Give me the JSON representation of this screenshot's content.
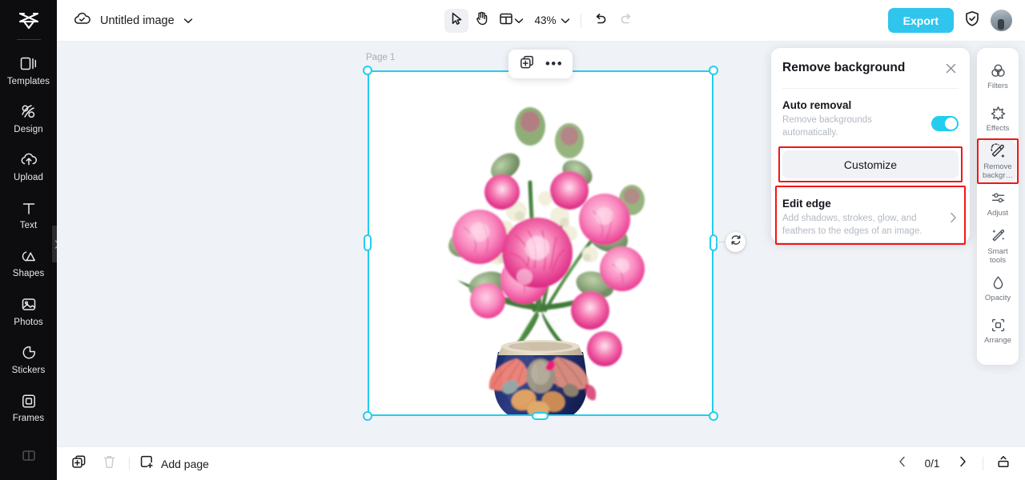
{
  "app": {
    "brand_icon": "capcut-logo-icon",
    "canvas_bg": "#eff2f6",
    "accent": "#22cdf0",
    "annotation_color": "#f31515"
  },
  "sidebar": {
    "items": [
      {
        "label": "Templates",
        "icon": "templates-icon"
      },
      {
        "label": "Design",
        "icon": "design-icon"
      },
      {
        "label": "Upload",
        "icon": "upload-cloud-icon"
      },
      {
        "label": "Text",
        "icon": "text-icon"
      },
      {
        "label": "Shapes",
        "icon": "shapes-icon"
      },
      {
        "label": "Photos",
        "icon": "photos-icon"
      },
      {
        "label": "Stickers",
        "icon": "stickers-icon"
      },
      {
        "label": "Frames",
        "icon": "frames-icon"
      }
    ],
    "collapse_icon": "chevron-right-icon"
  },
  "header": {
    "cloud_icon": "cloud-saved-icon",
    "doc_title": "Untitled image",
    "title_chevron": "chevron-down-icon",
    "tools": {
      "select_icon": "cursor-select-icon",
      "hand_icon": "hand-pan-icon",
      "layout_icon": "layout-grid-icon",
      "layout_chevron": "chevron-down-icon",
      "zoom_value": "43%",
      "zoom_chevron": "chevron-down-icon",
      "undo_icon": "undo-icon",
      "redo_icon": "redo-icon"
    },
    "export_label": "Export",
    "shield_icon": "shield-check-icon",
    "avatar_icon": "user-avatar"
  },
  "canvas": {
    "page_label": "Page 1",
    "float_toolbar": {
      "duplicate_icon": "duplicate-icon",
      "more_icon": "more-horizontal-icon"
    },
    "rotate_icon": "rotate-icon",
    "artwork_name": "pink-carnation-bouquet-in-seashell-vase"
  },
  "remove_bg_panel": {
    "title": "Remove background",
    "close_icon": "close-icon",
    "auto_removal": {
      "title": "Auto removal",
      "subtitle": "Remove backgrounds automatically.",
      "toggle_on": true
    },
    "customize_label": "Customize",
    "edit_edge": {
      "title": "Edit edge",
      "subtitle": "Add shadows, strokes, glow, and feathers to the edges of an image.",
      "chevron_icon": "chevron-right-icon"
    }
  },
  "right_rail": {
    "items": [
      {
        "label": "Filters",
        "icon": "filters-icon",
        "active": false
      },
      {
        "label": "Effects",
        "icon": "effects-icon",
        "active": false
      },
      {
        "label": "Remove backgr…",
        "icon": "remove-background-icon",
        "active": true
      },
      {
        "label": "Adjust",
        "icon": "adjust-sliders-icon",
        "active": false
      },
      {
        "label": "Smart tools",
        "icon": "smart-tools-icon",
        "active": false
      },
      {
        "label": "Opacity",
        "icon": "opacity-drop-icon",
        "active": false
      },
      {
        "label": "Arrange",
        "icon": "arrange-icon",
        "active": false
      }
    ]
  },
  "bottom_bar": {
    "duplicate_page_icon": "duplicate-page-icon",
    "delete_icon": "trash-icon",
    "add_page_label": "Add page",
    "add_page_icon": "add-page-icon",
    "prev_icon": "chevron-left-icon",
    "page_count": "0/1",
    "next_icon": "chevron-right-icon",
    "present_icon": "present-icon"
  }
}
